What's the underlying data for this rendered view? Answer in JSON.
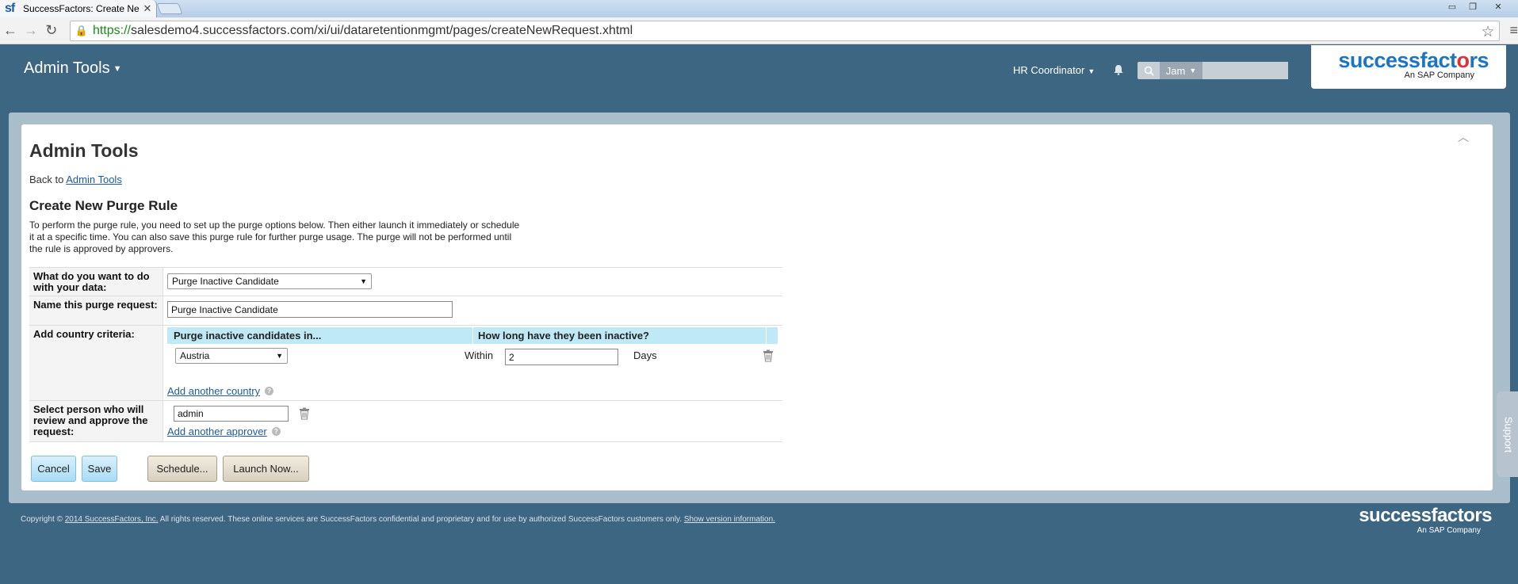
{
  "browser": {
    "tab_title": "SuccessFactors: Create Ne",
    "url_https": "https://",
    "url_rest": "salesdemo4.successfactors.com/xi/ui/dataretentionmgmt/pages/createNewRequest.xhtml"
  },
  "header": {
    "admin_menu": "Admin Tools",
    "role_menu": "HR Coordinator",
    "jam_label": "Jam",
    "logo_main": "successfactors",
    "logo_sub": "An SAP Company"
  },
  "page": {
    "title": "Admin Tools",
    "back_prefix": "Back to ",
    "back_link": "Admin Tools",
    "section_title": "Create New Purge Rule",
    "intro": "To perform the purge rule, you need to set up the purge options below. Then either launch it immediately or schedule it at a specific time. You can also save this purge rule for further purge usage. The purge will not be performed until the rule is approved by approvers."
  },
  "form": {
    "action_label": "What do you want to do with your data:",
    "action_value": "Purge Inactive Candidate",
    "name_label": "Name this purge request:",
    "name_value": "Purge Inactive Candidate",
    "country_label": "Add country criteria:",
    "criteria_headers": [
      "Purge inactive candidates in...",
      "How long have they been inactive?"
    ],
    "country_value": "Austria",
    "within_label": "Within",
    "days_value": "2",
    "days_label": "Days",
    "add_country": "Add another country",
    "approver_label": "Select person who will review and approve the request:",
    "approver_value": "admin",
    "add_approver": "Add another approver"
  },
  "buttons": {
    "cancel": "Cancel",
    "save": "Save",
    "schedule": "Schedule...",
    "launch": "Launch Now..."
  },
  "support_label": "Support",
  "footer": {
    "copyright_prefix": "Copyright © ",
    "company_link": "2014 SuccessFactors, Inc.",
    "rights_text": " All rights reserved. These online services are SuccessFactors confidential and proprietary and for use by authorized SuccessFactors customers only. ",
    "version_link": "Show version information."
  }
}
